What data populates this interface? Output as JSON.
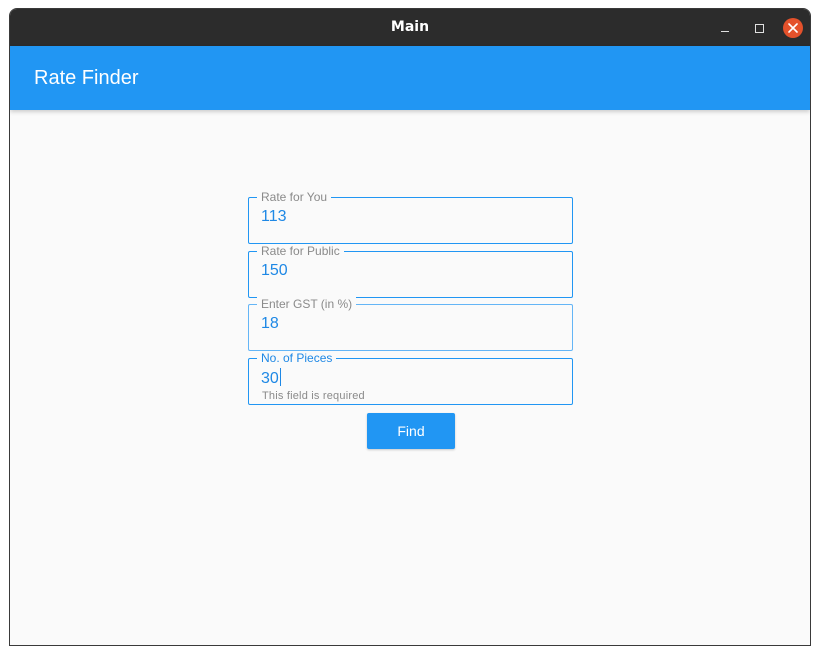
{
  "window": {
    "title": "Main"
  },
  "appbar": {
    "title": "Rate Finder"
  },
  "form": {
    "fields": [
      {
        "label": "Rate for You",
        "value": "113"
      },
      {
        "label": "Rate for Public",
        "value": "150"
      },
      {
        "label": "Enter GST (in %)",
        "value": "18"
      },
      {
        "label": "No. of Pieces",
        "value": "30",
        "helper": "This field is required"
      }
    ],
    "find_label": "Find"
  },
  "colors": {
    "primary": "#2196f3",
    "titlebar": "#2c2c2c",
    "close": "#e4512b"
  },
  "icons": {
    "minimize": "minimize-icon",
    "maximize": "maximize-icon",
    "close": "close-icon"
  }
}
